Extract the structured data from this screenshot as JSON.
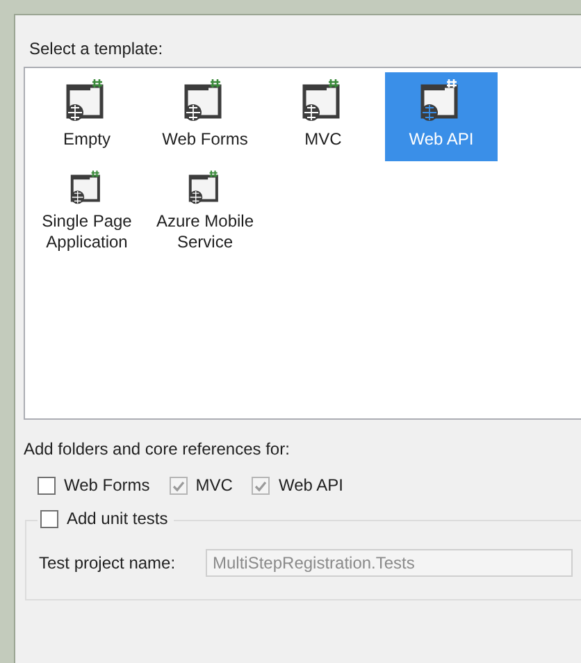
{
  "template_section": {
    "label": "Select a template:"
  },
  "templates": [
    {
      "label": "Empty",
      "selected": false
    },
    {
      "label": "Web Forms",
      "selected": false
    },
    {
      "label": "MVC",
      "selected": false
    },
    {
      "label": "Web API",
      "selected": true
    },
    {
      "label": "Single Page Application",
      "selected": false
    },
    {
      "label": "Azure Mobile Service",
      "selected": false
    }
  ],
  "references": {
    "label": "Add folders and core references for:",
    "options": [
      {
        "label": "Web Forms",
        "checked": false,
        "disabled": false
      },
      {
        "label": "MVC",
        "checked": true,
        "disabled": true
      },
      {
        "label": "Web API",
        "checked": true,
        "disabled": true
      }
    ]
  },
  "unit_tests": {
    "label": "Add unit tests",
    "checked": false,
    "field_label": "Test project name:",
    "field_value": "MultiStepRegistration.Tests",
    "disabled": true
  }
}
